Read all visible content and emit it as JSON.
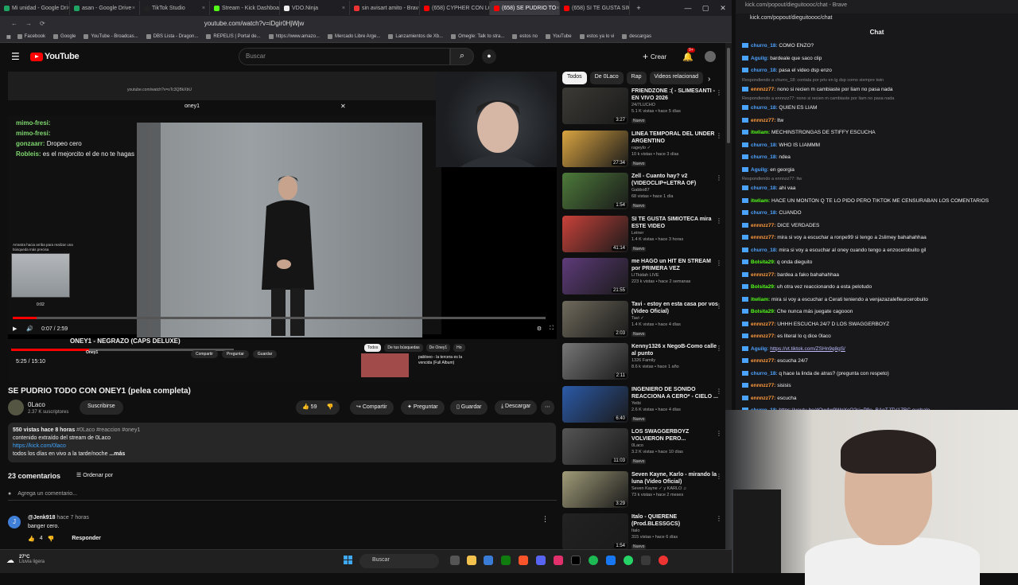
{
  "browser": {
    "tabs": [
      {
        "label": "Mi unidad - Google Dri",
        "color": "#1fa463"
      },
      {
        "label": "asan - Google Drive",
        "color": "#1fa463"
      },
      {
        "label": "TikTok Studio",
        "color": "#222"
      },
      {
        "label": "Stream - Kick Dashboard",
        "color": "#53fc18"
      },
      {
        "label": "VDO.Ninja",
        "color": "#eee"
      },
      {
        "label": "sin avisart amito - Brav",
        "color": "#e33"
      },
      {
        "label": "(658) CYPHER CON LOS",
        "color": "#f00"
      },
      {
        "label": "(658) SE PUDRIO TO",
        "color": "#f00",
        "active": true
      },
      {
        "label": "(658) SI TE GUSTA SIMI",
        "color": "#f00"
      }
    ],
    "url": "youtube.com/watch?v=iDgir0HjWjw",
    "bookmarks": [
      "Facebook",
      "Google",
      "YouTube - Broadcas...",
      "DBS Lista - Dragon...",
      "REPELIS | Portal de...",
      "https://www.amazo...",
      "Mercado Libre Arge...",
      "Lanzamientos de Xb...",
      "Omegle: Talk to stra...",
      "estos no",
      "YouTube",
      "estos ya lo vi",
      "descargas"
    ]
  },
  "youtube": {
    "search_placeholder": "Buscar",
    "create_label": "Crear",
    "notif_count": "9+",
    "player": {
      "inner_url": "youtube.com/watch?v=sTc3QBkXbU",
      "inner_search": "oney1",
      "overlay_chat": [
        {
          "user": "mimo-fresi:",
          "text": ""
        },
        {
          "user": "mimo-fresi:",
          "text": ""
        },
        {
          "user": "gonzaarr:",
          "text": "Dropeo cero"
        },
        {
          "user": "Robleis:",
          "text": "es el mejorcito el de no te hagas"
        }
      ],
      "scroll_hint": "Arrastra hacia arriba para realizar una búsqueda más precisa",
      "thumb_time": "0:02",
      "time": "0:07 / 2:59",
      "second_title": "ONEY1 - NEGRAZO (CAPS DELUXE)",
      "second_channel": "Oney1",
      "second_time": "5:25 / 15:10",
      "second_actions": [
        "Compartir",
        "Preguntar",
        "Guardar"
      ],
      "second_chips": [
        "Todos",
        "De tus búsquedas",
        "De Oney1",
        "Ho"
      ],
      "second_rec": "pabloeo - la tercera es la vencida (Full Album)"
    },
    "title": "SE PUDRIO TODO CON ONEY1 (pelea completa)",
    "channel": {
      "name": "0Laco",
      "subs": "2.37 K suscriptores",
      "subscribe": "Suscribirse"
    },
    "actions": {
      "likes": "59",
      "share": "Compartir",
      "ask": "Preguntar",
      "save": "Guardar",
      "download": "Descargar"
    },
    "description": {
      "meta": "550 vistas  hace 8 horas",
      "tags": "#0Laco #reaccion #oney1",
      "line1": "contenido extraído del stream de 0Laco",
      "link": "https://kick.com/0laco",
      "line2": "todos los días en vivo a la tarde/noche",
      "more": "...más"
    },
    "comments": {
      "count": "23 comentarios",
      "order": "Ordenar por",
      "add": "Agrega un comentario...",
      "first": {
        "user": "@Jenk918",
        "when": "hace 7 horas",
        "text": "banger cero.",
        "likes": "4",
        "reply": "Responder"
      }
    },
    "chips": [
      "Todos",
      "De 0Laco",
      "Rap",
      "Videos relacionad"
    ],
    "recs": [
      {
        "title": "FRIENDZONE :( - SLIMESANTI - EN VIVO 2026",
        "channel": "24/7LUCHO",
        "meta": "5.1 K vistas • hace 5 días",
        "dur": "3:27",
        "badge": "Nuevo",
        "bg": "#3b3a35"
      },
      {
        "title": "LINEA TEMPORAL DEL UNDER ARGENTINO",
        "channel": "rageylo ✓",
        "meta": "10 k vistas • hace 3 días",
        "dur": "27:34",
        "badge": "Nuevo",
        "bg": "#d9a441"
      },
      {
        "title": "Zell - Cuanto hay? v2 (VIDEOCLIP+LETRA OF)",
        "channel": "Gabbo87",
        "meta": "68 vistas • hace 1 día",
        "dur": "1:54",
        "badge": "Nuevo",
        "bg": "#4d7a3a"
      },
      {
        "title": "SI TE GUSTA SIMIOTECA mira ESTE VIDEO",
        "channel": "Leiner",
        "meta": "1.4 K vistas • hace 3 horas",
        "dur": "41:14",
        "badge": "Nuevo",
        "bg": "#c9423a"
      },
      {
        "title": "me HAGO un HIT EN STREAM por PRIMERA VEZ",
        "channel": "LITkidah LIVE",
        "meta": "223 k vistas • hace 2 semanas",
        "dur": "21:55",
        "badge": "",
        "bg": "#5e3b7a"
      },
      {
        "title": "Tavi - estoy en esta casa por vos (Video Oficial)",
        "channel": "Tavi ✓",
        "meta": "1.4 K vistas • hace 4 días",
        "dur": "2:03",
        "badge": "Nuevo",
        "bg": "#6f6a5c"
      },
      {
        "title": "Kenny1326 x NegoB-Como calle al punto",
        "channel": "1326 Family",
        "meta": "8.6 k vistas • hace 1 año",
        "dur": "2:11",
        "badge": "",
        "bg": "#777"
      },
      {
        "title": "INGENIERO DE SONIDO REACCIONA A CERO* - CIELO ...",
        "channel": "Yeibi",
        "meta": "2.6 K vistas • hace 4 días",
        "dur": "6:40",
        "badge": "Nuevo",
        "bg": "#2b5aa8"
      },
      {
        "title": "LOS SWAGGERBOYZ VOLVIERON PERO...",
        "channel": "0Laco",
        "meta": "3.2 K vistas • hace 10 días",
        "dur": "11:03",
        "badge": "Nuevo",
        "bg": "#555"
      },
      {
        "title": "Seven Kayne, Karlo - mirando la luna (Video Oficial)",
        "channel": "Seven Kayne ✓ y KARLO ♫",
        "meta": "73 k vistas • hace 2 meses",
        "dur": "3:29",
        "badge": "",
        "bg": "#a09b78"
      },
      {
        "title": "Italo - QUIERENE (Prod.BLESSGCS)",
        "channel": "Italo",
        "meta": "315 vistas • hace 6 días",
        "dur": "1:54",
        "badge": "Nuevo",
        "bg": "#222"
      }
    ]
  },
  "chat": {
    "window_title": "kick.com/popout/dieguitoooc/chat - Brave",
    "url": "kick.com/popout/dieguitoooc/chat",
    "title": "Chat",
    "messages": [
      {
        "user": "churro_18:",
        "color": "#4ea3ff",
        "text": "COMO ENZO?"
      },
      {
        "user": "Aguilg:",
        "color": "#4ea3ff",
        "text": "bardeale que saco clip"
      },
      {
        "user": "churro_18:",
        "color": "#4ea3ff",
        "text": "pasa el video dsp enzo"
      },
      {
        "reply": "Respondiendo a churro_18: contala por priv en lg dsp como siempre twin"
      },
      {
        "user": "ennnzz77:",
        "color": "#ff9a3c",
        "text": "nono si recien m cambiaste por liam no pasa nada"
      },
      {
        "reply": "Respondiendo a ennnzz77: nono si recien m cambiaste por liam no pasa nada"
      },
      {
        "user": "churro_18:",
        "color": "#4ea3ff",
        "text": "QUIEN ES LIAM"
      },
      {
        "user": "ennnzz77:",
        "color": "#ff9a3c",
        "text": "ltw"
      },
      {
        "user": "itwliam:",
        "color": "#53fc18",
        "text": "MECHINSTRONGAS DE STIFFY ESCUCHA"
      },
      {
        "user": "churro_18:",
        "color": "#4ea3ff",
        "text": "WHO IS LIAMMM"
      },
      {
        "user": "churro_18:",
        "color": "#4ea3ff",
        "text": "ndea"
      },
      {
        "user": "Aguilg:",
        "color": "#4ea3ff",
        "text": "en georgia"
      },
      {
        "reply": "Respondiendo a ennnzz77: ltw"
      },
      {
        "user": "churro_18:",
        "color": "#4ea3ff",
        "text": "ahi vaa"
      },
      {
        "user": "itwliam:",
        "color": "#53fc18",
        "text": "HACE UN MONTON Q TE LO PIDO PERO TIKTOK ME CENSURABAN LOS COMENTARIOS"
      },
      {
        "user": "churro_18:",
        "color": "#4ea3ff",
        "text": "CUANDO"
      },
      {
        "user": "ennnzz77:",
        "color": "#ff9a3c",
        "text": "DICE VERDADES"
      },
      {
        "user": "ennnzz77:",
        "color": "#ff9a3c",
        "text": "mira si voy a escuchar a ronpe99 si tengo a 2slimey bahahahhaa"
      },
      {
        "user": "churro_18:",
        "color": "#4ea3ff",
        "text": "mira si voy a escuchar al oney cuando tengo a enzocerobuito gil"
      },
      {
        "user": "Bolsita29:",
        "color": "#53fc18",
        "text": "q onda dieguito"
      },
      {
        "user": "ennnzz77:",
        "color": "#ff9a3c",
        "text": "bardea a fako bahahahhaa"
      },
      {
        "user": "Bolsita29:",
        "color": "#53fc18",
        "text": "uh otra vez reaccionando a esta pelotudo"
      },
      {
        "user": "itwliam:",
        "color": "#53fc18",
        "text": "mira si voy a escuchar a Cerati teniendo a venjazazalefleurcerobuito"
      },
      {
        "user": "Bolsita29:",
        "color": "#53fc18",
        "text": "Che nunca más juegate cagooon"
      },
      {
        "user": "ennnzz77:",
        "color": "#ff9a3c",
        "text": "UHHH ESCUCHA 24/7 D LOS SWAGGERBOYZ"
      },
      {
        "user": "ennnzz77:",
        "color": "#ff9a3c",
        "text": "es literal lo q dice 0laco"
      },
      {
        "user": "Aguilg:",
        "color": "#4ea3ff",
        "link": "https://vt.tiktok.com/ZSHn9q8gS/"
      },
      {
        "user": "ennnzz77:",
        "color": "#ff9a3c",
        "text": "escucha 24/7"
      },
      {
        "user": "churro_18:",
        "color": "#4ea3ff",
        "text": "q hace la linda de atras? (pregunta con respeto)"
      },
      {
        "user": "ennnzz77:",
        "color": "#ff9a3c",
        "text": "sisisis"
      },
      {
        "user": "ennnzz77:",
        "color": "#ff9a3c",
        "text": "escucha"
      },
      {
        "user": "churro_18:",
        "color": "#4ea3ff",
        "link": "https://youtu.be/dQw4w9WgXcQ?si=P9e_BAnTJTV1ZBC cuchalo"
      }
    ]
  },
  "taskbar": {
    "temp": "27°C",
    "weather": "Lluvia ligera",
    "search": "Buscar"
  }
}
